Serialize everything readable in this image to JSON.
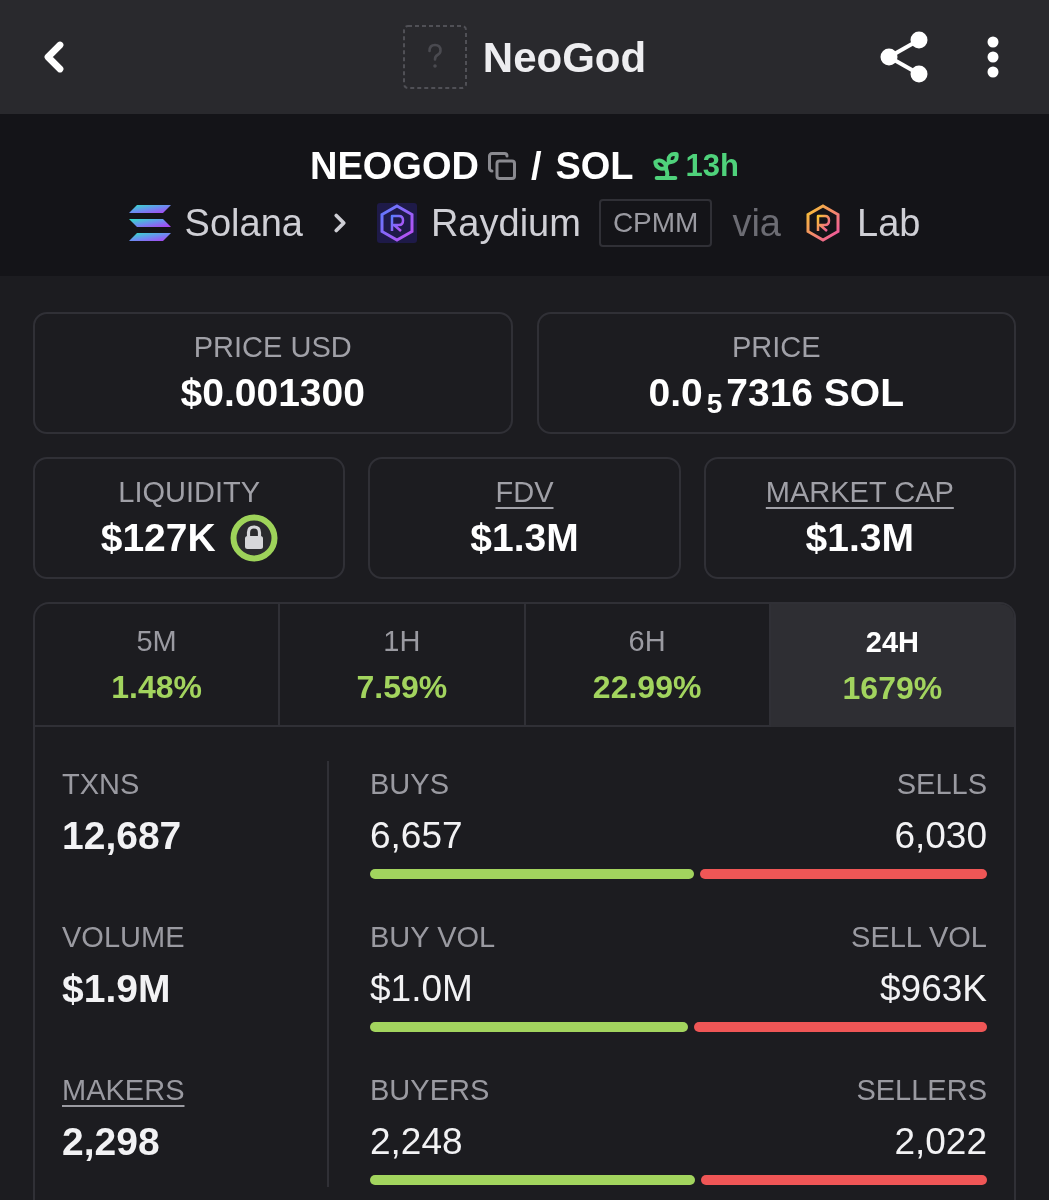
{
  "header": {
    "title": "NeoGod"
  },
  "pair": {
    "base": "NEOGOD",
    "separator": "/",
    "quote": "SOL",
    "age": "13h"
  },
  "route": {
    "chain": "Solana",
    "dex": "Raydium",
    "pool_type": "CPMM",
    "via": "via",
    "launchpad": "Lab"
  },
  "prices": [
    {
      "label": "PRICE USD",
      "value": "$0.001300"
    },
    {
      "label": "PRICE",
      "value": "0.0$_{5}$7316 SOL"
    }
  ],
  "metrics": [
    {
      "label": "LIQUIDITY",
      "value": "$127K",
      "underlined": false,
      "locked": true
    },
    {
      "label": "FDV",
      "value": "$1.3M",
      "underlined": true,
      "locked": false
    },
    {
      "label": "MARKET CAP",
      "value": "$1.3M",
      "underlined": true,
      "locked": false
    }
  ],
  "timeframes": [
    {
      "label": "5M",
      "change": "1.48%",
      "selected": false
    },
    {
      "label": "1H",
      "change": "7.59%",
      "selected": false
    },
    {
      "label": "6H",
      "change": "22.99%",
      "selected": false
    },
    {
      "label": "24H",
      "change": "1679%",
      "selected": true
    }
  ],
  "totals": [
    {
      "label": "TXNS",
      "value": "12,687",
      "underlined": false
    },
    {
      "label": "VOLUME",
      "value": "$1.9M",
      "underlined": false
    },
    {
      "label": "MAKERS",
      "value": "2,298",
      "underlined": true
    }
  ],
  "splits": [
    {
      "buy_label": "BUYS",
      "buy_value": "6,657",
      "sell_label": "SELLS",
      "sell_value": "6,030",
      "level": 0.525
    },
    {
      "buy_label": "BUY VOL",
      "buy_value": "$1.0M",
      "sell_label": "SELL VOL",
      "sell_value": "$963K",
      "level": 0.515
    },
    {
      "buy_label": "BUYERS",
      "buy_value": "2,248",
      "sell_label": "SELLERS",
      "sell_value": "2,022",
      "level": 0.526
    }
  ]
}
